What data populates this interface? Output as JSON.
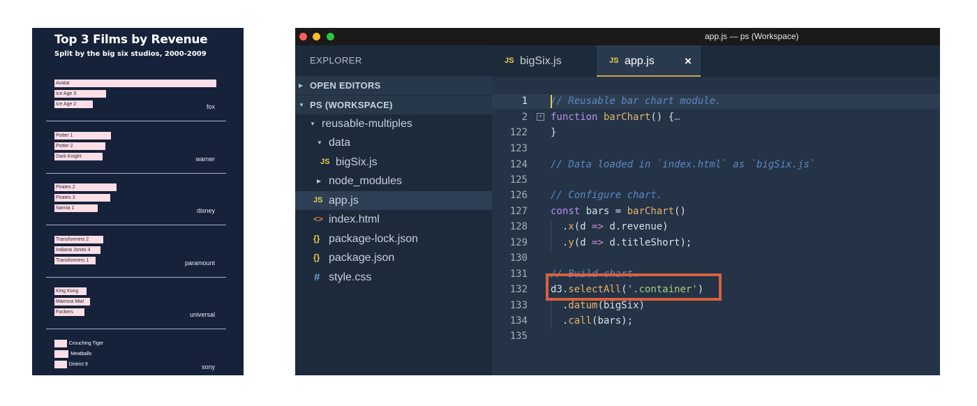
{
  "chart_data": {
    "type": "bar",
    "title": "Top 3 Films by Revenue",
    "subtitle": "Split by the big six studios, 2000-2009",
    "xlabel": "",
    "ylabel": "",
    "xlim": [
      0,
      2800
    ],
    "facets": [
      {
        "studio": "fox",
        "films": [
          {
            "title": "Avatar",
            "revenue": 2790
          },
          {
            "title": "Ice Age 3",
            "revenue": 887
          },
          {
            "title": "Ice Age 2",
            "revenue": 661
          }
        ]
      },
      {
        "studio": "warner",
        "films": [
          {
            "title": "Potter 1",
            "revenue": 975
          },
          {
            "title": "Potter 2",
            "revenue": 880
          },
          {
            "title": "Dark Knight",
            "revenue": 824
          }
        ]
      },
      {
        "studio": "disney",
        "films": [
          {
            "title": "Pirates 2",
            "revenue": 1066
          },
          {
            "title": "Pirates 3",
            "revenue": 963
          },
          {
            "title": "Narnia 1",
            "revenue": 745
          }
        ]
      },
      {
        "studio": "paramount",
        "films": [
          {
            "title": "Transformers 2",
            "revenue": 836
          },
          {
            "title": "Indiana Jones 4",
            "revenue": 787
          },
          {
            "title": "Transformers 1",
            "revenue": 709
          }
        ]
      },
      {
        "studio": "universal",
        "films": [
          {
            "title": "King Kong",
            "revenue": 550
          },
          {
            "title": "Mamma Mia!",
            "revenue": 609
          },
          {
            "title": "Fockers",
            "revenue": 516
          }
        ]
      },
      {
        "studio": "sony",
        "films": [
          {
            "title": "Crouching Tiger",
            "revenue": 214
          },
          {
            "title": "Meatballs",
            "revenue": 243
          },
          {
            "title": "District 9",
            "revenue": 211
          }
        ]
      }
    ]
  },
  "window": {
    "title": "app.js — ps (Workspace)"
  },
  "sidebar": {
    "header": "EXPLORER",
    "open_editors": "OPEN EDITORS",
    "workspace": "PS (WORKSPACE)",
    "items": [
      {
        "label": "reusable-multiples"
      },
      {
        "label": "data"
      },
      {
        "label": "bigSix.js"
      },
      {
        "label": "node_modules"
      },
      {
        "label": "app.js"
      },
      {
        "label": "index.html"
      },
      {
        "label": "package-lock.json"
      },
      {
        "label": "package.json"
      },
      {
        "label": "style.css"
      }
    ],
    "icons": {
      "js": "JS",
      "html": "<>",
      "json": "{}",
      "css": "#"
    }
  },
  "tabs": [
    {
      "icon": "JS",
      "label": "bigSix.js"
    },
    {
      "icon": "JS",
      "label": "app.js",
      "close": "×"
    }
  ],
  "editor": {
    "line_numbers": [
      "1",
      "2",
      "122",
      "123",
      "124",
      "125",
      "126",
      "127",
      "128",
      "129",
      "130",
      "131",
      "132",
      "133",
      "134",
      "135"
    ],
    "tokens": {
      "l1": "// Reusable bar chart module.",
      "l2_kw": "function",
      "l2_fn": "barChart",
      "l2_rest": "() {",
      "l2_fold": "…",
      "l122": "}",
      "l124": "// Data loaded in `index.html` as `bigSix.js`",
      "l126": "// Configure chart.",
      "l127_kw": "const",
      "l127_var": " bars = ",
      "l127_fn": "barChart",
      "l127_rest": "()",
      "l128_a": "  .",
      "l128_fn": "x",
      "l128_b": "(d ",
      "l128_arrow": "=>",
      "l128_c": " d.revenue)",
      "l129_a": "  .",
      "l129_fn": "y",
      "l129_b": "(d ",
      "l129_arrow": "=>",
      "l129_c": " d.titleShort);",
      "l131": "// Build chart.",
      "l132_a": "d3.",
      "l132_fn": "selectAll",
      "l132_b": "(",
      "l132_str": "'.container'",
      "l132_c": ")",
      "l133_a": "  .",
      "l133_fn": "datum",
      "l133_b": "(bigSix)",
      "l134_a": "  .",
      "l134_fn": "call",
      "l134_b": "(bars);"
    }
  },
  "colors": {
    "bar": "#fbdee6",
    "chart_bg": "#16213a",
    "editor_bg": "#243346",
    "highlight": "#d9613e"
  }
}
